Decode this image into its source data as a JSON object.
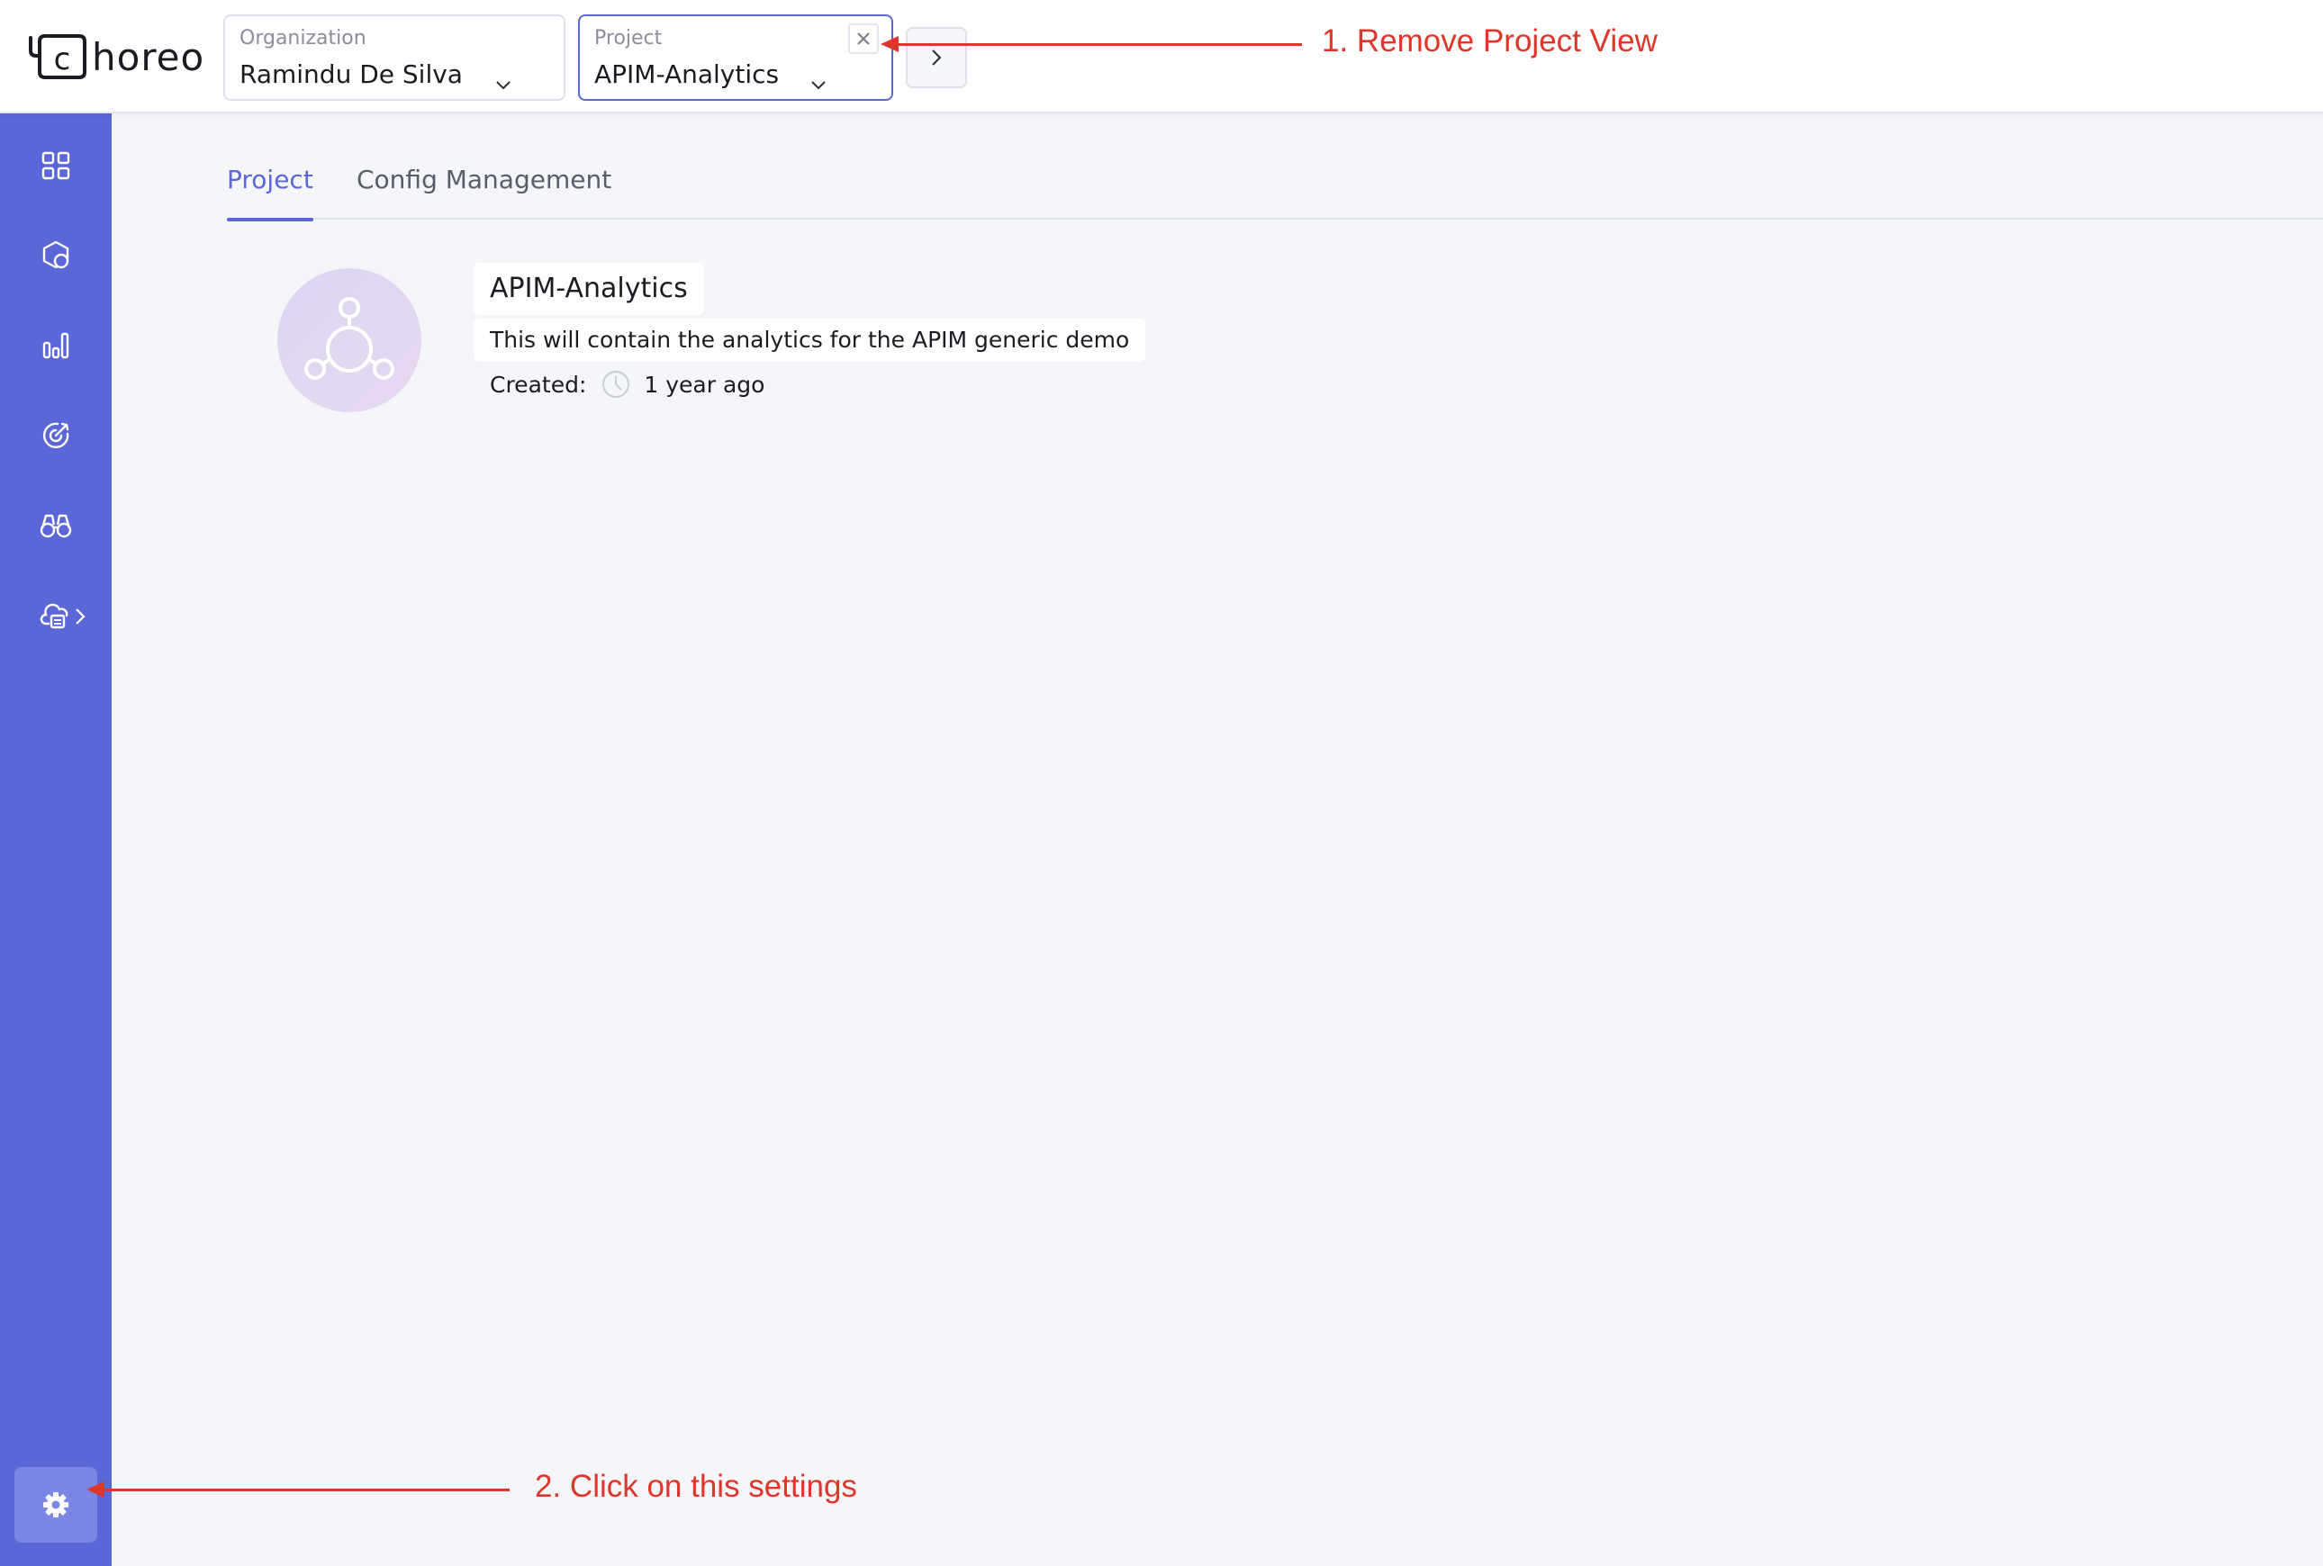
{
  "app": {
    "logo_text": "horeo",
    "logo_mark_letter": "c"
  },
  "header": {
    "organization": {
      "label": "Organization",
      "value": "Ramindu De Silva"
    },
    "project": {
      "label": "Project",
      "value": "APIM-Analytics"
    }
  },
  "sidebar": {
    "items": [
      {
        "icon": "grid-icon"
      },
      {
        "icon": "components-icon"
      },
      {
        "icon": "bar-chart-icon"
      },
      {
        "icon": "target-icon"
      },
      {
        "icon": "binoculars-icon"
      },
      {
        "icon": "cloud-deploy-icon"
      }
    ],
    "settings_icon": "gear-icon"
  },
  "tabs": {
    "project": "Project",
    "config": "Config Management"
  },
  "project": {
    "name": "APIM-Analytics",
    "description": "This will contain the analytics for the APIM generic demo",
    "created_label": "Created:",
    "created_value": "1 year ago"
  },
  "annotations": {
    "step1": "1. Remove Project View",
    "step2": "2. Click on this settings"
  },
  "colors": {
    "accent": "#5b67d6",
    "sidebar": "#5b67d6",
    "annotation": "#e0352b"
  }
}
